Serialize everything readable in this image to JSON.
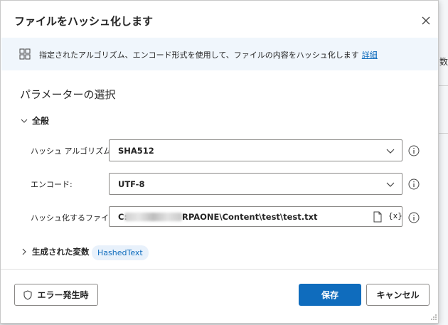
{
  "dialog": {
    "title": "ファイルをハッシュ化します",
    "close_icon": "close-icon"
  },
  "info": {
    "icon": "action-icon",
    "text": "指定されたアルゴリズム、エンコード形式を使用して、ファイルの内容をハッシュ化します",
    "link": "詳細"
  },
  "section": {
    "title": "パラメーターの選択"
  },
  "general": {
    "label": "全般",
    "fields": {
      "algorithm": {
        "label": "ハッシュ アルゴリズム:",
        "value": "SHA512"
      },
      "encoding": {
        "label": "エンコード:",
        "value": "UTF-8"
      },
      "file": {
        "label": "ハッシュ化するファイル:",
        "value_prefix": "C:",
        "value_suffix": "RPAONE\\Content\\test\\test.txt",
        "var_icon": "{x}"
      }
    }
  },
  "output": {
    "label": "生成された変数",
    "variable": "HashedText"
  },
  "footer": {
    "error_button": "エラー発生時",
    "save_button": "保存",
    "cancel_button": "キャンセル"
  },
  "background": {
    "partial_text": "数"
  },
  "colors": {
    "accent": "#0f6cbd",
    "banner": "#f0f6fc",
    "chip": "#e8f1fb"
  }
}
